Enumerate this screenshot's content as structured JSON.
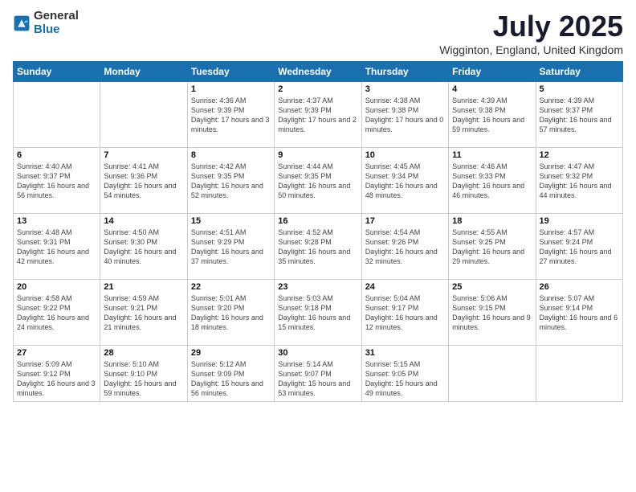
{
  "logo": {
    "general": "General",
    "blue": "Blue"
  },
  "header": {
    "title": "July 2025",
    "subtitle": "Wigginton, England, United Kingdom"
  },
  "weekdays": [
    "Sunday",
    "Monday",
    "Tuesday",
    "Wednesday",
    "Thursday",
    "Friday",
    "Saturday"
  ],
  "weeks": [
    [
      null,
      null,
      {
        "day": 1,
        "sunrise": "4:36 AM",
        "sunset": "9:39 PM",
        "daylight": "17 hours and 3 minutes."
      },
      {
        "day": 2,
        "sunrise": "4:37 AM",
        "sunset": "9:39 PM",
        "daylight": "17 hours and 2 minutes."
      },
      {
        "day": 3,
        "sunrise": "4:38 AM",
        "sunset": "9:38 PM",
        "daylight": "17 hours and 0 minutes."
      },
      {
        "day": 4,
        "sunrise": "4:39 AM",
        "sunset": "9:38 PM",
        "daylight": "16 hours and 59 minutes."
      },
      {
        "day": 5,
        "sunrise": "4:39 AM",
        "sunset": "9:37 PM",
        "daylight": "16 hours and 57 minutes."
      }
    ],
    [
      {
        "day": 6,
        "sunrise": "4:40 AM",
        "sunset": "9:37 PM",
        "daylight": "16 hours and 56 minutes."
      },
      {
        "day": 7,
        "sunrise": "4:41 AM",
        "sunset": "9:36 PM",
        "daylight": "16 hours and 54 minutes."
      },
      {
        "day": 8,
        "sunrise": "4:42 AM",
        "sunset": "9:35 PM",
        "daylight": "16 hours and 52 minutes."
      },
      {
        "day": 9,
        "sunrise": "4:44 AM",
        "sunset": "9:35 PM",
        "daylight": "16 hours and 50 minutes."
      },
      {
        "day": 10,
        "sunrise": "4:45 AM",
        "sunset": "9:34 PM",
        "daylight": "16 hours and 48 minutes."
      },
      {
        "day": 11,
        "sunrise": "4:46 AM",
        "sunset": "9:33 PM",
        "daylight": "16 hours and 46 minutes."
      },
      {
        "day": 12,
        "sunrise": "4:47 AM",
        "sunset": "9:32 PM",
        "daylight": "16 hours and 44 minutes."
      }
    ],
    [
      {
        "day": 13,
        "sunrise": "4:48 AM",
        "sunset": "9:31 PM",
        "daylight": "16 hours and 42 minutes."
      },
      {
        "day": 14,
        "sunrise": "4:50 AM",
        "sunset": "9:30 PM",
        "daylight": "16 hours and 40 minutes."
      },
      {
        "day": 15,
        "sunrise": "4:51 AM",
        "sunset": "9:29 PM",
        "daylight": "16 hours and 37 minutes."
      },
      {
        "day": 16,
        "sunrise": "4:52 AM",
        "sunset": "9:28 PM",
        "daylight": "16 hours and 35 minutes."
      },
      {
        "day": 17,
        "sunrise": "4:54 AM",
        "sunset": "9:26 PM",
        "daylight": "16 hours and 32 minutes."
      },
      {
        "day": 18,
        "sunrise": "4:55 AM",
        "sunset": "9:25 PM",
        "daylight": "16 hours and 29 minutes."
      },
      {
        "day": 19,
        "sunrise": "4:57 AM",
        "sunset": "9:24 PM",
        "daylight": "16 hours and 27 minutes."
      }
    ],
    [
      {
        "day": 20,
        "sunrise": "4:58 AM",
        "sunset": "9:22 PM",
        "daylight": "16 hours and 24 minutes."
      },
      {
        "day": 21,
        "sunrise": "4:59 AM",
        "sunset": "9:21 PM",
        "daylight": "16 hours and 21 minutes."
      },
      {
        "day": 22,
        "sunrise": "5:01 AM",
        "sunset": "9:20 PM",
        "daylight": "16 hours and 18 minutes."
      },
      {
        "day": 23,
        "sunrise": "5:03 AM",
        "sunset": "9:18 PM",
        "daylight": "16 hours and 15 minutes."
      },
      {
        "day": 24,
        "sunrise": "5:04 AM",
        "sunset": "9:17 PM",
        "daylight": "16 hours and 12 minutes."
      },
      {
        "day": 25,
        "sunrise": "5:06 AM",
        "sunset": "9:15 PM",
        "daylight": "16 hours and 9 minutes."
      },
      {
        "day": 26,
        "sunrise": "5:07 AM",
        "sunset": "9:14 PM",
        "daylight": "16 hours and 6 minutes."
      }
    ],
    [
      {
        "day": 27,
        "sunrise": "5:09 AM",
        "sunset": "9:12 PM",
        "daylight": "16 hours and 3 minutes."
      },
      {
        "day": 28,
        "sunrise": "5:10 AM",
        "sunset": "9:10 PM",
        "daylight": "15 hours and 59 minutes."
      },
      {
        "day": 29,
        "sunrise": "5:12 AM",
        "sunset": "9:09 PM",
        "daylight": "15 hours and 56 minutes."
      },
      {
        "day": 30,
        "sunrise": "5:14 AM",
        "sunset": "9:07 PM",
        "daylight": "15 hours and 53 minutes."
      },
      {
        "day": 31,
        "sunrise": "5:15 AM",
        "sunset": "9:05 PM",
        "daylight": "15 hours and 49 minutes."
      },
      null,
      null
    ]
  ]
}
